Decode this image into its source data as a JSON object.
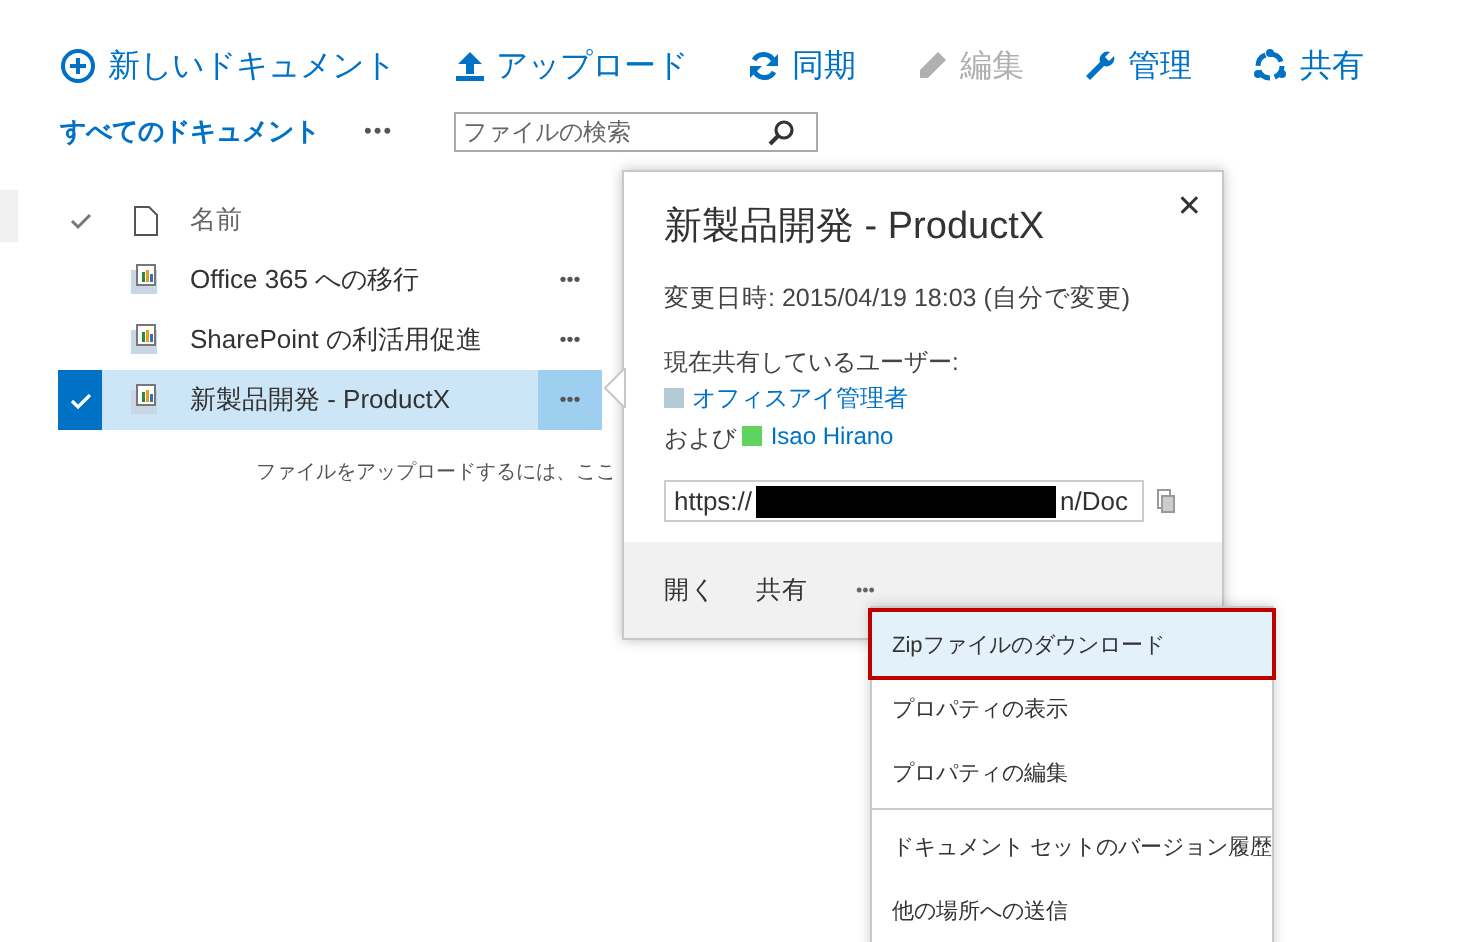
{
  "toolbar": [
    {
      "kind": "new",
      "label": "新しいドキュメント",
      "disabled": false
    },
    {
      "kind": "upload",
      "label": "アップロード",
      "disabled": false
    },
    {
      "kind": "sync",
      "label": "同期",
      "disabled": false
    },
    {
      "kind": "edit",
      "label": "編集",
      "disabled": true
    },
    {
      "kind": "manage",
      "label": "管理",
      "disabled": false
    },
    {
      "kind": "share",
      "label": "共有",
      "disabled": false
    }
  ],
  "view": {
    "label": "すべてのドキュメント",
    "more": "•••"
  },
  "search": {
    "placeholder": "ファイルの検索"
  },
  "list": {
    "column": "名前",
    "rows": [
      {
        "name": "Office 365 への移行",
        "more": "•••",
        "selected": false
      },
      {
        "name": "SharePoint の利活用促進",
        "more": "•••",
        "selected": false
      },
      {
        "name": "新製品開発 - ProductX",
        "more": "•••",
        "selected": true
      }
    ],
    "empty_hint": "ファイルをアップロードするには、ここ"
  },
  "callout": {
    "title": "新製品開発 - ProductX",
    "close": "✕",
    "modified": "変更日時: 2015/04/19 18:03 (自分で変更)",
    "shared_label": "現在共有しているユーザー:",
    "users": [
      {
        "name": "オフィスアイ管理者",
        "color": "#b4cad6"
      },
      {
        "name": "Isao Hirano",
        "color": "#5dd55d"
      }
    ],
    "and": "および",
    "url_start": "https://",
    "url_end": "n/Doc",
    "actions": [
      "開く",
      "共有",
      "•••"
    ]
  },
  "menu": [
    {
      "label": "Zipファイルのダウンロード",
      "selected": true,
      "divider_before": false
    },
    {
      "label": "プロパティの表示",
      "selected": false,
      "divider_before": false
    },
    {
      "label": "プロパティの編集",
      "selected": false,
      "divider_before": false
    },
    {
      "label": "ドキュメント セットのバージョン履歴",
      "selected": false,
      "divider_before": true
    },
    {
      "label": "他の場所への送信",
      "selected": false,
      "divider_before": false
    }
  ]
}
